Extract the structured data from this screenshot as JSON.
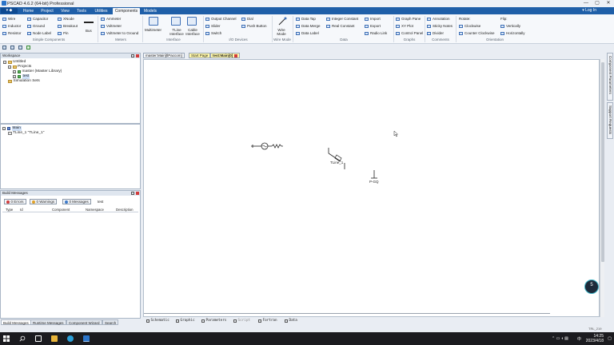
{
  "window": {
    "title": "PSCAD 4.6.2 (64-bit) Professional",
    "controls": [
      "—",
      "▢",
      "✕"
    ]
  },
  "menu": {
    "file_label": "",
    "tabs": [
      "Home",
      "Project",
      "View",
      "Tools",
      "Utilities",
      "Components",
      "Models"
    ],
    "active_tab": "Components",
    "login": "Log In"
  },
  "ribbon": {
    "simple": {
      "items": [
        "Wire",
        "Inductor",
        "Resistor",
        "Capacitor",
        "Ground",
        "Node Label",
        "XNode",
        "Breakout",
        "Pin",
        "Bus"
      ],
      "group": "Simple Components"
    },
    "meters": {
      "items": [
        "Ammeter",
        "Voltmeter",
        "Voltmeter to Ground"
      ],
      "group": "Meters"
    },
    "interface": {
      "items": [
        "Multimeter",
        "TLine Interface",
        "Cable Interface"
      ],
      "group": "Interface"
    },
    "io": {
      "items": [
        "Output Channel",
        "Slider",
        "Switch",
        "Dial",
        "Push Button"
      ],
      "group": "I/O Devices"
    },
    "wire": {
      "items": [
        "Wire Mode"
      ],
      "group": "Wire Mode"
    },
    "data": {
      "items": [
        "Data Tap",
        "Data Merge",
        "Data Label",
        "Integer Constant",
        "Real Constant",
        "Import",
        "Export",
        "Radio Link"
      ],
      "group": "Data"
    },
    "graphs": {
      "items": [
        "Graph Pane",
        "XY Plot",
        "Control Panel"
      ],
      "group": "Graphs"
    },
    "comments": {
      "items": [
        "Annotation",
        "Sticky Notes",
        "Divider"
      ],
      "group": "Comments"
    },
    "orientation": {
      "items": [
        "Rotate:",
        "Clockwise",
        "Counter Clockwise",
        "Flip:",
        "Vertically",
        "Horizontally"
      ],
      "group": "Orientation"
    }
  },
  "workspace": {
    "title": "Workspace",
    "tree": {
      "root": "Untitled",
      "projects": "Projects",
      "items": [
        "master (Master Library)",
        "test"
      ],
      "sim": "Simulation Sets"
    }
  },
  "hierarchy": {
    "root": "Main",
    "child": "TLine_1 \"TLine_1\""
  },
  "build": {
    "title": "Build Messages",
    "buttons": [
      "0 Errors",
      "0 Warnings",
      "0 Messages"
    ],
    "filter": "test",
    "columns": [
      "Type",
      "Id",
      "Component",
      "Namespace",
      "Description"
    ],
    "tabs": [
      "Build Messages",
      "Runtime Messages",
      "Component Wizard",
      "Search"
    ]
  },
  "docs": {
    "tabs": [
      "master:Main[tlPaccom]",
      "Start Page",
      "test:Main[0]"
    ]
  },
  "canvas": {
    "component_label": "TLine_1",
    "ground_label": "P-GQ",
    "bottom_tabs": [
      "Schematic",
      "Graphic",
      "Parameters",
      "Script",
      "Fortran",
      "Data"
    ]
  },
  "side_panels": [
    "Component Parameters",
    "Support Requests"
  ],
  "status": {
    "text": "TRL_219"
  },
  "badge": {
    "value": "5"
  },
  "taskbar": {
    "time": "14:25",
    "date": "2023/4/18",
    "lang": "中"
  },
  "colors": {
    "ribbon_tab": "#1f5fa8",
    "accent": "#2b74c9",
    "error": "#d23b3b",
    "warning": "#e0a127",
    "info": "#3b79c9"
  }
}
